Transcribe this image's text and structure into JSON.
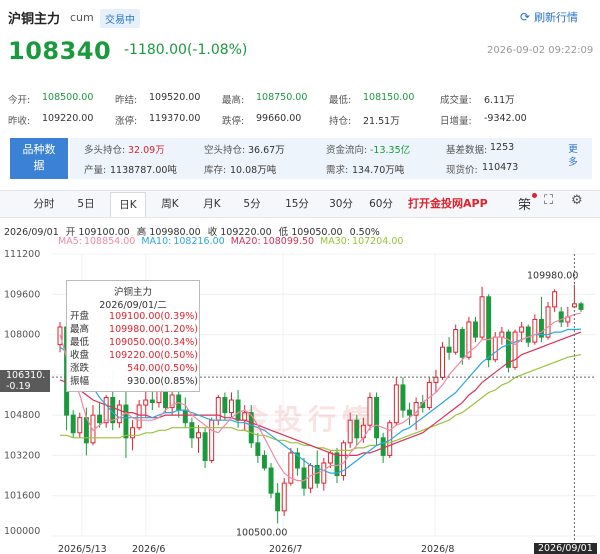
{
  "header": {
    "title": "沪铜主力",
    "code": "cum",
    "status_badge": "交易中",
    "refresh_label": "刷新行情",
    "price": "108340",
    "change": "-1180.00(-1.08%)",
    "timestamp": "2026-09-02 09:22:09"
  },
  "stats": {
    "row1": [
      {
        "label": "今开:",
        "value": "108500.00",
        "color": "green"
      },
      {
        "label": "昨结:",
        "value": "109520.00",
        "color": "dark"
      },
      {
        "label": "最高:",
        "value": "108750.00",
        "color": "green"
      },
      {
        "label": "最低:",
        "value": "108150.00",
        "color": "green"
      },
      {
        "label": "成交量:",
        "value": "6.11万",
        "color": "dark"
      }
    ],
    "row2": [
      {
        "label": "昨收:",
        "value": "109220.00",
        "color": "dark"
      },
      {
        "label": "涨停:",
        "value": "119370.00",
        "color": "dark"
      },
      {
        "label": "跌停:",
        "value": "99660.00",
        "color": "dark"
      },
      {
        "label": "持仓:",
        "value": "21.51万",
        "color": "dark"
      },
      {
        "label": "日增量:",
        "value": "-9342.00",
        "color": "dark"
      }
    ]
  },
  "variety": {
    "box_label": "品种数据",
    "row1": [
      {
        "label": "多头持仓:",
        "value": "32.09万",
        "color": "red"
      },
      {
        "label": "空头持仓:",
        "value": "36.67万",
        "color": "dark"
      },
      {
        "label": "资金流向:",
        "value": "-13.35亿",
        "color": "green"
      },
      {
        "label": "基差数据:",
        "value": "1253",
        "color": "dark"
      }
    ],
    "row2": [
      {
        "label": "产量:",
        "value": "1138787.00吨",
        "color": "dark"
      },
      {
        "label": "库存:",
        "value": "10.08万吨",
        "color": "dark"
      },
      {
        "label": "需求:",
        "value": "134.70万吨",
        "color": "dark"
      },
      {
        "label": "现货价:",
        "value": "110473",
        "color": "dark"
      }
    ],
    "more_label": "更多"
  },
  "tabs": [
    "分时",
    "5日",
    "日K",
    "周K",
    "月K",
    "5分",
    "15分",
    "30分",
    "60分"
  ],
  "active_tab": "日K",
  "app_link": "打开金投网APP",
  "toolbar": {
    "fuquan": "筞",
    "fullscreen": "fullscreen-icon",
    "settings": "settings-icon"
  },
  "ohlc_line": {
    "date": "2026/09/01",
    "open_label": "开",
    "open": "109100.00",
    "high_label": "高",
    "high": "109980.00",
    "close_label": "收",
    "close": "109220.00",
    "low_label": "低",
    "low": "109050.00",
    "pct": "0.50%"
  },
  "ma_line": [
    {
      "label": "MA5:",
      "value": "108854.00",
      "color": "#f08aa6"
    },
    {
      "label": "MA10:",
      "value": "108216.00",
      "color": "#2aa8e0"
    },
    {
      "label": "MA20:",
      "value": "108099.50",
      "color": "#d8335a"
    },
    {
      "label": "MA30:",
      "value": "107204.00",
      "color": "#9bc23a"
    }
  ],
  "tooltip": {
    "title": "沪铜主力",
    "date": "2026/09/01/二",
    "rows": [
      {
        "label": "开盘",
        "value": "109100.00(0.39%)",
        "color": "red"
      },
      {
        "label": "最高",
        "value": "109980.00(1.20%)",
        "color": "red"
      },
      {
        "label": "最低",
        "value": "109050.00(0.34%)",
        "color": "red"
      },
      {
        "label": "收盘",
        "value": "109220.00(0.50%)",
        "color": "red"
      },
      {
        "label": "涨跌",
        "value": "540.00(0.50%)",
        "color": "red"
      },
      {
        "label": "振幅",
        "value": "930.00(0.85%)",
        "color": "dark"
      }
    ]
  },
  "cursor_price": {
    "price": "106310.",
    "change": "-0.19"
  },
  "watermark": "金投行情",
  "last_date_label": "2026/09/01",
  "chart_data": {
    "type": "candlestick",
    "y_ticks": [
      "111200",
      "109600",
      "108000",
      "106400",
      "104800",
      "103200",
      "101600",
      "100000"
    ],
    "ylim": [
      100000,
      111200
    ],
    "x_ticks": [
      "2026/5/13",
      "2026/6",
      "2026/7",
      "2026/8"
    ],
    "max_label": "109980.00",
    "min_label": "100500.00",
    "cursor_price": 106310,
    "colors": {
      "up": "#e0242e",
      "down": "#1a9a3c",
      "ma5": "#f08aa6",
      "ma10": "#2aa8e0",
      "ma20": "#d8335a",
      "ma30": "#9bc23a"
    },
    "candles": [
      [
        107600,
        108500,
        107300,
        108300
      ],
      [
        108300,
        108500,
        104200,
        104800
      ],
      [
        104800,
        105000,
        103900,
        104100
      ],
      [
        104100,
        104900,
        103900,
        104700
      ],
      [
        104700,
        105100,
        103200,
        103700
      ],
      [
        103700,
        105200,
        103600,
        104800
      ],
      [
        104800,
        105300,
        104300,
        104500
      ],
      [
        104500,
        105600,
        104300,
        105500
      ],
      [
        105500,
        106600,
        104200,
        104500
      ],
      [
        104500,
        105400,
        104300,
        105200
      ],
      [
        105200,
        105800,
        103100,
        103900
      ],
      [
        103900,
        104600,
        103400,
        104300
      ],
      [
        104300,
        105400,
        104200,
        105200
      ],
      [
        105200,
        105900,
        104700,
        105400
      ],
      [
        105400,
        106200,
        105000,
        105300
      ],
      [
        105300,
        106500,
        105100,
        106300
      ],
      [
        106300,
        106500,
        104900,
        105100
      ],
      [
        105100,
        105900,
        104800,
        105600
      ],
      [
        105600,
        105800,
        104700,
        105000
      ],
      [
        105000,
        105500,
        104300,
        104500
      ],
      [
        104500,
        104700,
        103500,
        103900
      ],
      [
        103900,
        104400,
        103300,
        104100
      ],
      [
        104100,
        104300,
        102700,
        103000
      ],
      [
        103000,
        104700,
        102900,
        104600
      ],
      [
        104600,
        105600,
        104400,
        105500
      ],
      [
        105500,
        105700,
        104600,
        104900
      ],
      [
        104900,
        105700,
        104700,
        105400
      ],
      [
        105400,
        105800,
        104300,
        104600
      ],
      [
        104600,
        105200,
        104200,
        104900
      ],
      [
        104900,
        105200,
        103500,
        103700
      ],
      [
        103700,
        104100,
        102900,
        103200
      ],
      [
        103200,
        103400,
        102600,
        102700
      ],
      [
        102700,
        102900,
        101500,
        101700
      ],
      [
        101700,
        102100,
        100500,
        101000
      ],
      [
        101000,
        102300,
        100800,
        102100
      ],
      [
        102100,
        103500,
        102000,
        103300
      ],
      [
        103300,
        103500,
        102400,
        102700
      ],
      [
        102700,
        103100,
        101600,
        101900
      ],
      [
        101900,
        102900,
        101700,
        102800
      ],
      [
        102800,
        103400,
        101900,
        102100
      ],
      [
        102100,
        103100,
        101800,
        102900
      ],
      [
        102900,
        103400,
        102700,
        103300
      ],
      [
        103300,
        103500,
        102100,
        102400
      ],
      [
        102400,
        103800,
        102200,
        103700
      ],
      [
        103700,
        104900,
        103500,
        104600
      ],
      [
        104600,
        104800,
        103600,
        103900
      ],
      [
        103900,
        104700,
        103700,
        104400
      ],
      [
        104400,
        105700,
        104200,
        105500
      ],
      [
        105500,
        105700,
        103600,
        103900
      ],
      [
        103900,
        104100,
        102900,
        103200
      ],
      [
        103200,
        104600,
        103100,
        104500
      ],
      [
        104500,
        106300,
        104400,
        106000
      ],
      [
        106000,
        106300,
        104700,
        105000
      ],
      [
        105000,
        105300,
        104400,
        104800
      ],
      [
        104800,
        105500,
        104200,
        105300
      ],
      [
        105300,
        105600,
        104900,
        105100
      ],
      [
        105100,
        106300,
        105000,
        106100
      ],
      [
        106100,
        106600,
        105700,
        106300
      ],
      [
        106300,
        107700,
        106200,
        107500
      ],
      [
        107500,
        107900,
        107000,
        107300
      ],
      [
        107300,
        108400,
        107200,
        108200
      ],
      [
        108200,
        108300,
        106800,
        107100
      ],
      [
        107100,
        108700,
        107000,
        108500
      ],
      [
        108500,
        108700,
        107700,
        107900
      ],
      [
        107900,
        109900,
        107800,
        109500
      ],
      [
        109500,
        109600,
        106700,
        107000
      ],
      [
        107000,
        108100,
        106900,
        107900
      ],
      [
        107900,
        108300,
        107600,
        108100
      ],
      [
        108100,
        108200,
        106500,
        106700
      ],
      [
        106700,
        108200,
        106600,
        108100
      ],
      [
        108100,
        108500,
        107700,
        108300
      ],
      [
        108300,
        108400,
        107500,
        107700
      ],
      [
        107700,
        108800,
        107600,
        108600
      ],
      [
        108600,
        109500,
        107700,
        107900
      ],
      [
        107900,
        109300,
        107800,
        109100
      ],
      [
        109100,
        109800,
        108900,
        109700
      ],
      [
        108900,
        109100,
        108300,
        108500
      ],
      [
        108500,
        109100,
        108300,
        108700
      ],
      [
        109100,
        109980,
        109050,
        109220
      ],
      [
        109220,
        109300,
        108900,
        109000
      ]
    ],
    "ma5": [
      108000,
      107100,
      106300,
      105600,
      104700,
      104200,
      104400,
      104600,
      104600,
      104700,
      104900,
      104700,
      104600,
      104600,
      104600,
      104700,
      105000,
      105200,
      105300,
      105200,
      104800,
      104600,
      104400,
      104200,
      104100,
      104400,
      104700,
      104900,
      105000,
      104800,
      104400,
      103900,
      103400,
      102900,
      102500,
      102300,
      102200,
      102200,
      102400,
      102500,
      102600,
      102800,
      102800,
      102900,
      103300,
      103600,
      103900,
      104300,
      104400,
      104300,
      104200,
      104400,
      104500,
      104700,
      104900,
      105300,
      105500,
      105700,
      106000,
      106400,
      106700,
      107000,
      107300,
      107500,
      107800,
      107800,
      107900,
      107900,
      107800,
      107600,
      107800,
      107900,
      108000,
      108100,
      108300,
      108500,
      108600,
      108700,
      108800,
      108850
    ],
    "ma10": [
      107500,
      107300,
      107000,
      106700,
      106300,
      105900,
      105500,
      105200,
      104900,
      104700,
      104700,
      104700,
      104700,
      104700,
      104700,
      104800,
      104900,
      104900,
      105000,
      105000,
      104900,
      104800,
      104700,
      104600,
      104600,
      104600,
      104600,
      104500,
      104500,
      104400,
      104300,
      104200,
      104000,
      103800,
      103600,
      103400,
      103200,
      103000,
      102800,
      102700,
      102600,
      102500,
      102500,
      102600,
      102800,
      103000,
      103200,
      103400,
      103600,
      103700,
      103800,
      104000,
      104200,
      104300,
      104500,
      104700,
      104900,
      105100,
      105300,
      105500,
      105700,
      106000,
      106300,
      106600,
      106900,
      107100,
      107300,
      107500,
      107600,
      107700,
      107800,
      107900,
      108000,
      108000,
      108000,
      108100,
      108100,
      108200,
      108200,
      108216
    ],
    "ma20": [
      106200,
      106100,
      106000,
      105800,
      105600,
      105400,
      105300,
      105200,
      105100,
      105000,
      104900,
      104900,
      104800,
      104800,
      104700,
      104700,
      104800,
      104800,
      104800,
      104800,
      104800,
      104800,
      104800,
      104800,
      104800,
      104700,
      104700,
      104600,
      104600,
      104500,
      104400,
      104300,
      104200,
      104100,
      104000,
      103900,
      103800,
      103700,
      103600,
      103500,
      103400,
      103300,
      103200,
      103200,
      103200,
      103200,
      103300,
      103300,
      103400,
      103500,
      103600,
      103700,
      103800,
      103900,
      104000,
      104100,
      104300,
      104500,
      104700,
      104900,
      105100,
      105300,
      105600,
      105800,
      106100,
      106300,
      106500,
      106700,
      106900,
      107000,
      107200,
      107300,
      107400,
      107500,
      107600,
      107700,
      107800,
      107900,
      108000,
      108099
    ],
    "ma30": [
      104000,
      104000,
      103900,
      103900,
      103900,
      103900,
      103900,
      103900,
      103900,
      103900,
      104000,
      104000,
      104000,
      104100,
      104100,
      104200,
      104200,
      104300,
      104300,
      104300,
      104300,
      104300,
      104300,
      104300,
      104300,
      104300,
      104300,
      104200,
      104200,
      104100,
      104000,
      104000,
      103900,
      103800,
      103800,
      103700,
      103700,
      103600,
      103600,
      103500,
      103500,
      103400,
      103400,
      103400,
      103400,
      103500,
      103500,
      103600,
      103600,
      103700,
      103700,
      103800,
      103900,
      104000,
      104100,
      104200,
      104300,
      104400,
      104500,
      104600,
      104800,
      104900,
      105100,
      105300,
      105500,
      105700,
      105800,
      106000,
      106100,
      106300,
      106400,
      106500,
      106600,
      106700,
      106800,
      106900,
      107000,
      107100,
      107150,
      107204
    ]
  }
}
